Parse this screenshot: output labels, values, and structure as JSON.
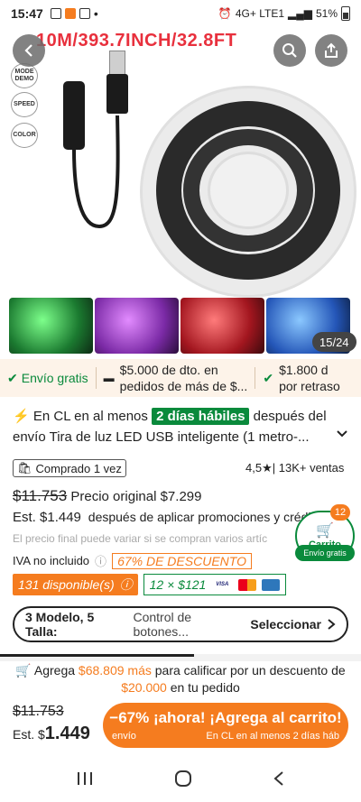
{
  "status_bar": {
    "time": "15:47",
    "network": "4G+ LTE1",
    "battery": "51%"
  },
  "hero": {
    "title": "10M/393.7INCH/32.8FT",
    "controller_labels": [
      "MODE DEMO",
      "SPEED",
      "COLOR"
    ],
    "page_counter": "15/24",
    "thumb_colors": [
      "#2fa84a",
      "#8b3bb8",
      "#b8202a",
      "#2a67c9"
    ]
  },
  "promo": {
    "free_shipping": "Envío gratis",
    "coupon_line1": "$5.000 de dto. en",
    "coupon_line2": "pedidos de más de $...",
    "delay_line1": "$1.800 d",
    "delay_line2": "por retraso"
  },
  "delivery": {
    "prefix": "En CL en al menos",
    "badge": "2 días hábiles",
    "suffix": "después del envío",
    "product_title": "Tira de luz LED USB inteligente (1 metro-..."
  },
  "product": {
    "bought": "Comprado 1 vez",
    "rating": "4,5",
    "sales": "13K+ ventas",
    "old_price": "$11.753",
    "original_price": "Precio original $7.299",
    "est_price": "Est. $1.449",
    "est_note": "después de aplicar promociones y crédit",
    "final_note": "El precio final puede variar si se compran varios artíc",
    "iva": "IVA no incluido",
    "discount": "67% DE DESCUENTO",
    "available": "131 disponible(s)",
    "installments": "12 × $121",
    "payment_cards": [
      "VISA",
      "MC",
      "AMEX"
    ]
  },
  "cart_float": {
    "count": "12",
    "label": "Carrito",
    "free": "Envío gratis"
  },
  "variant": {
    "summary": "3 Modelo, 5 Talla:",
    "value": "Control de botones...",
    "action": "Seleccionar"
  },
  "agrega": {
    "prefix": "Agrega",
    "amount": "$68.809 más",
    "middle": "para calificar por un descuento de",
    "discount": "$20.000",
    "suffix": "en tu pedido"
  },
  "bottom": {
    "old_price": "$11.753",
    "est_prefix": "Est. $",
    "est_value": "1.449",
    "cta_main": "−67% ¡ahora! ¡Agrega al carrito!",
    "cta_sub_left": "envío",
    "cta_sub_right": "En CL en al menos 2 días háb"
  }
}
